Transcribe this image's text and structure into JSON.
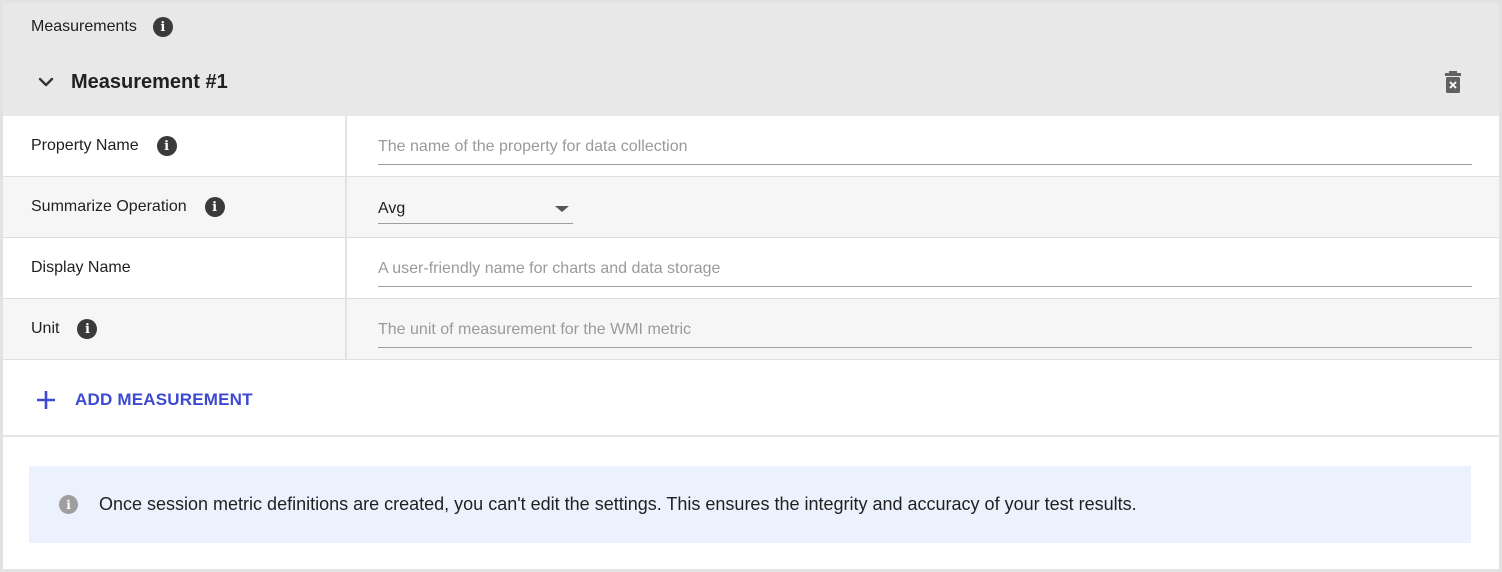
{
  "section": {
    "title": "Measurements",
    "info_icon": "info-icon"
  },
  "measurement": {
    "title": "Measurement #1",
    "collapse_icon": "chevron-down-icon",
    "delete_icon": "trash-icon"
  },
  "fields": {
    "property_name": {
      "label": "Property Name",
      "placeholder": "The name of the property for data collection",
      "value": "",
      "has_info": true
    },
    "summarize_operation": {
      "label": "Summarize Operation",
      "selected": "Avg",
      "has_info": true
    },
    "display_name": {
      "label": "Display Name",
      "placeholder": "A user-friendly name for charts and data storage",
      "value": "",
      "has_info": false
    },
    "unit": {
      "label": "Unit",
      "placeholder": "The unit of measurement for the WMI metric",
      "value": "",
      "has_info": true
    }
  },
  "actions": {
    "add_measurement": "ADD MEASUREMENT",
    "add_icon": "plus-icon"
  },
  "notice": {
    "text": "Once session metric definitions are created, you can't edit the settings. This ensures the integrity and accuracy of your test results.",
    "icon": "info-icon"
  },
  "colors": {
    "header_bg": "#e8e8e8",
    "alt_row_bg": "#f6f6f6",
    "accent": "#3d4ad0",
    "notice_bg": "#ecf2fd"
  }
}
